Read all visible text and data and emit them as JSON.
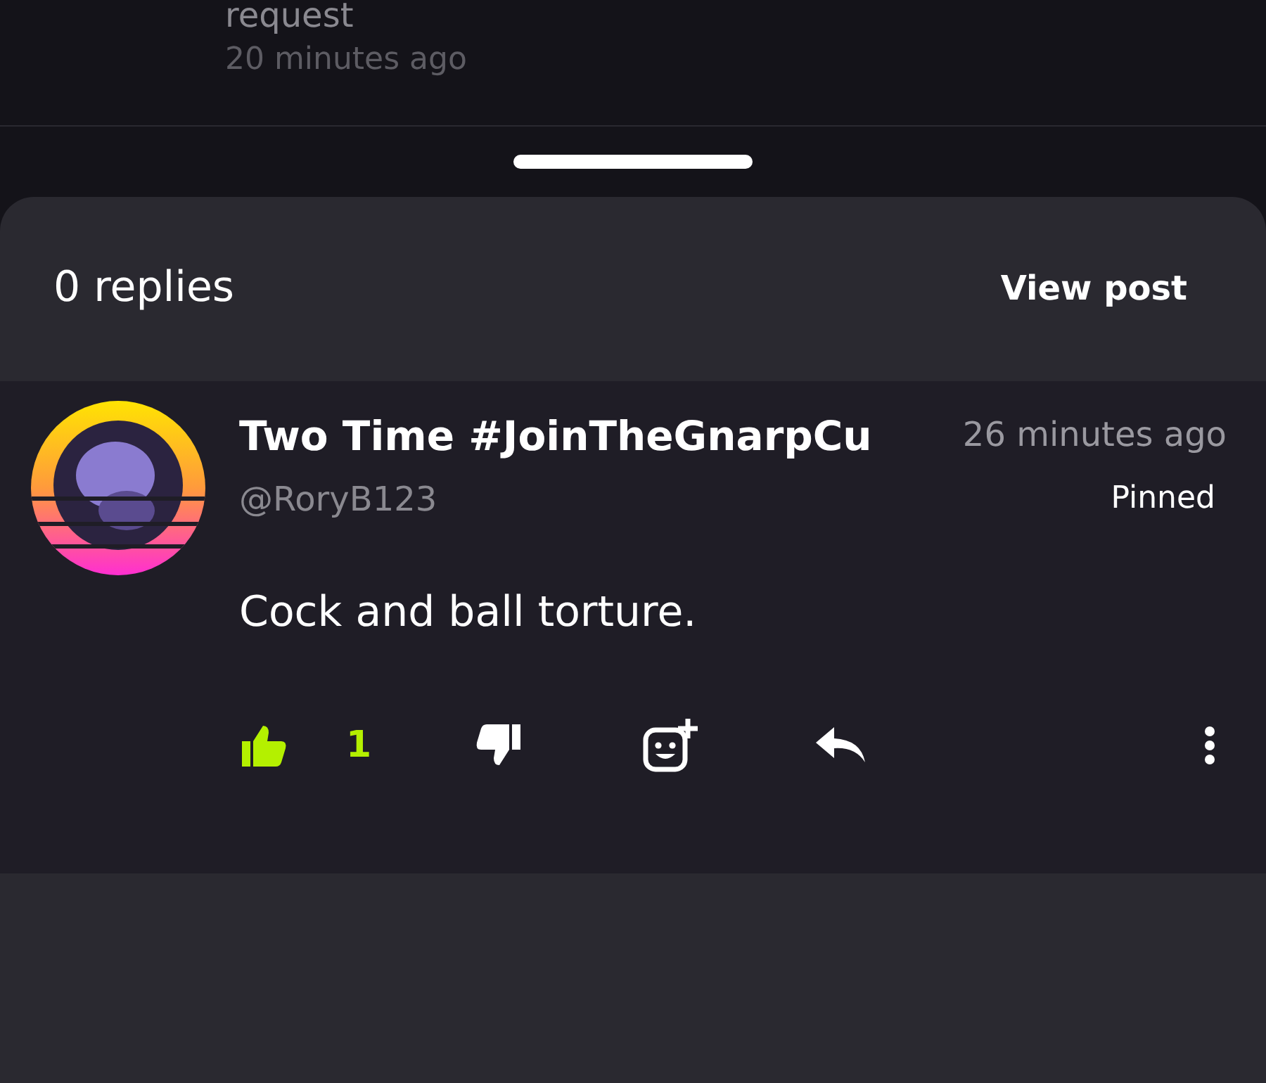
{
  "background_item": {
    "text": "request",
    "time": "20 minutes ago"
  },
  "sheet": {
    "reply_count": "0 replies",
    "view_post": "View post"
  },
  "comment": {
    "author": "Two Time #JoinTheGnarpCu",
    "handle": "@RoryB123",
    "time": "26 minutes ago",
    "pinned_label": "Pinned",
    "body": "Cock and ball torture.",
    "liked": true,
    "likes": "1"
  }
}
